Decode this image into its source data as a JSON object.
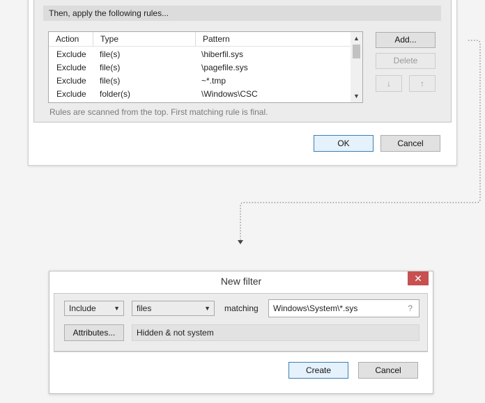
{
  "top_dialog": {
    "section_title": "Then, apply the following rules...",
    "columns": [
      "Action",
      "Type",
      "Pattern"
    ],
    "rows": [
      {
        "action": "Exclude",
        "type": "file(s)",
        "pattern": "\\hiberfil.sys"
      },
      {
        "action": "Exclude",
        "type": "file(s)",
        "pattern": "\\pagefile.sys"
      },
      {
        "action": "Exclude",
        "type": "file(s)",
        "pattern": "~*.tmp"
      },
      {
        "action": "Exclude",
        "type": "folder(s)",
        "pattern": "\\Windows\\CSC"
      }
    ],
    "buttons": {
      "add": "Add...",
      "delete": "Delete",
      "move_down": "↓",
      "move_up": "↑"
    },
    "hint": "Rules are scanned from the top. First matching rule is final.",
    "ok": "OK",
    "cancel": "Cancel"
  },
  "new_filter": {
    "title": "New filter",
    "close_glyph": "✕",
    "action_value": "Include",
    "type_value": "files",
    "matching_label": "matching",
    "pattern_value": "Windows\\System\\*.sys",
    "help_glyph": "?",
    "attributes_button": "Attributes...",
    "attributes_value": "Hidden & not system",
    "create": "Create",
    "cancel": "Cancel"
  }
}
